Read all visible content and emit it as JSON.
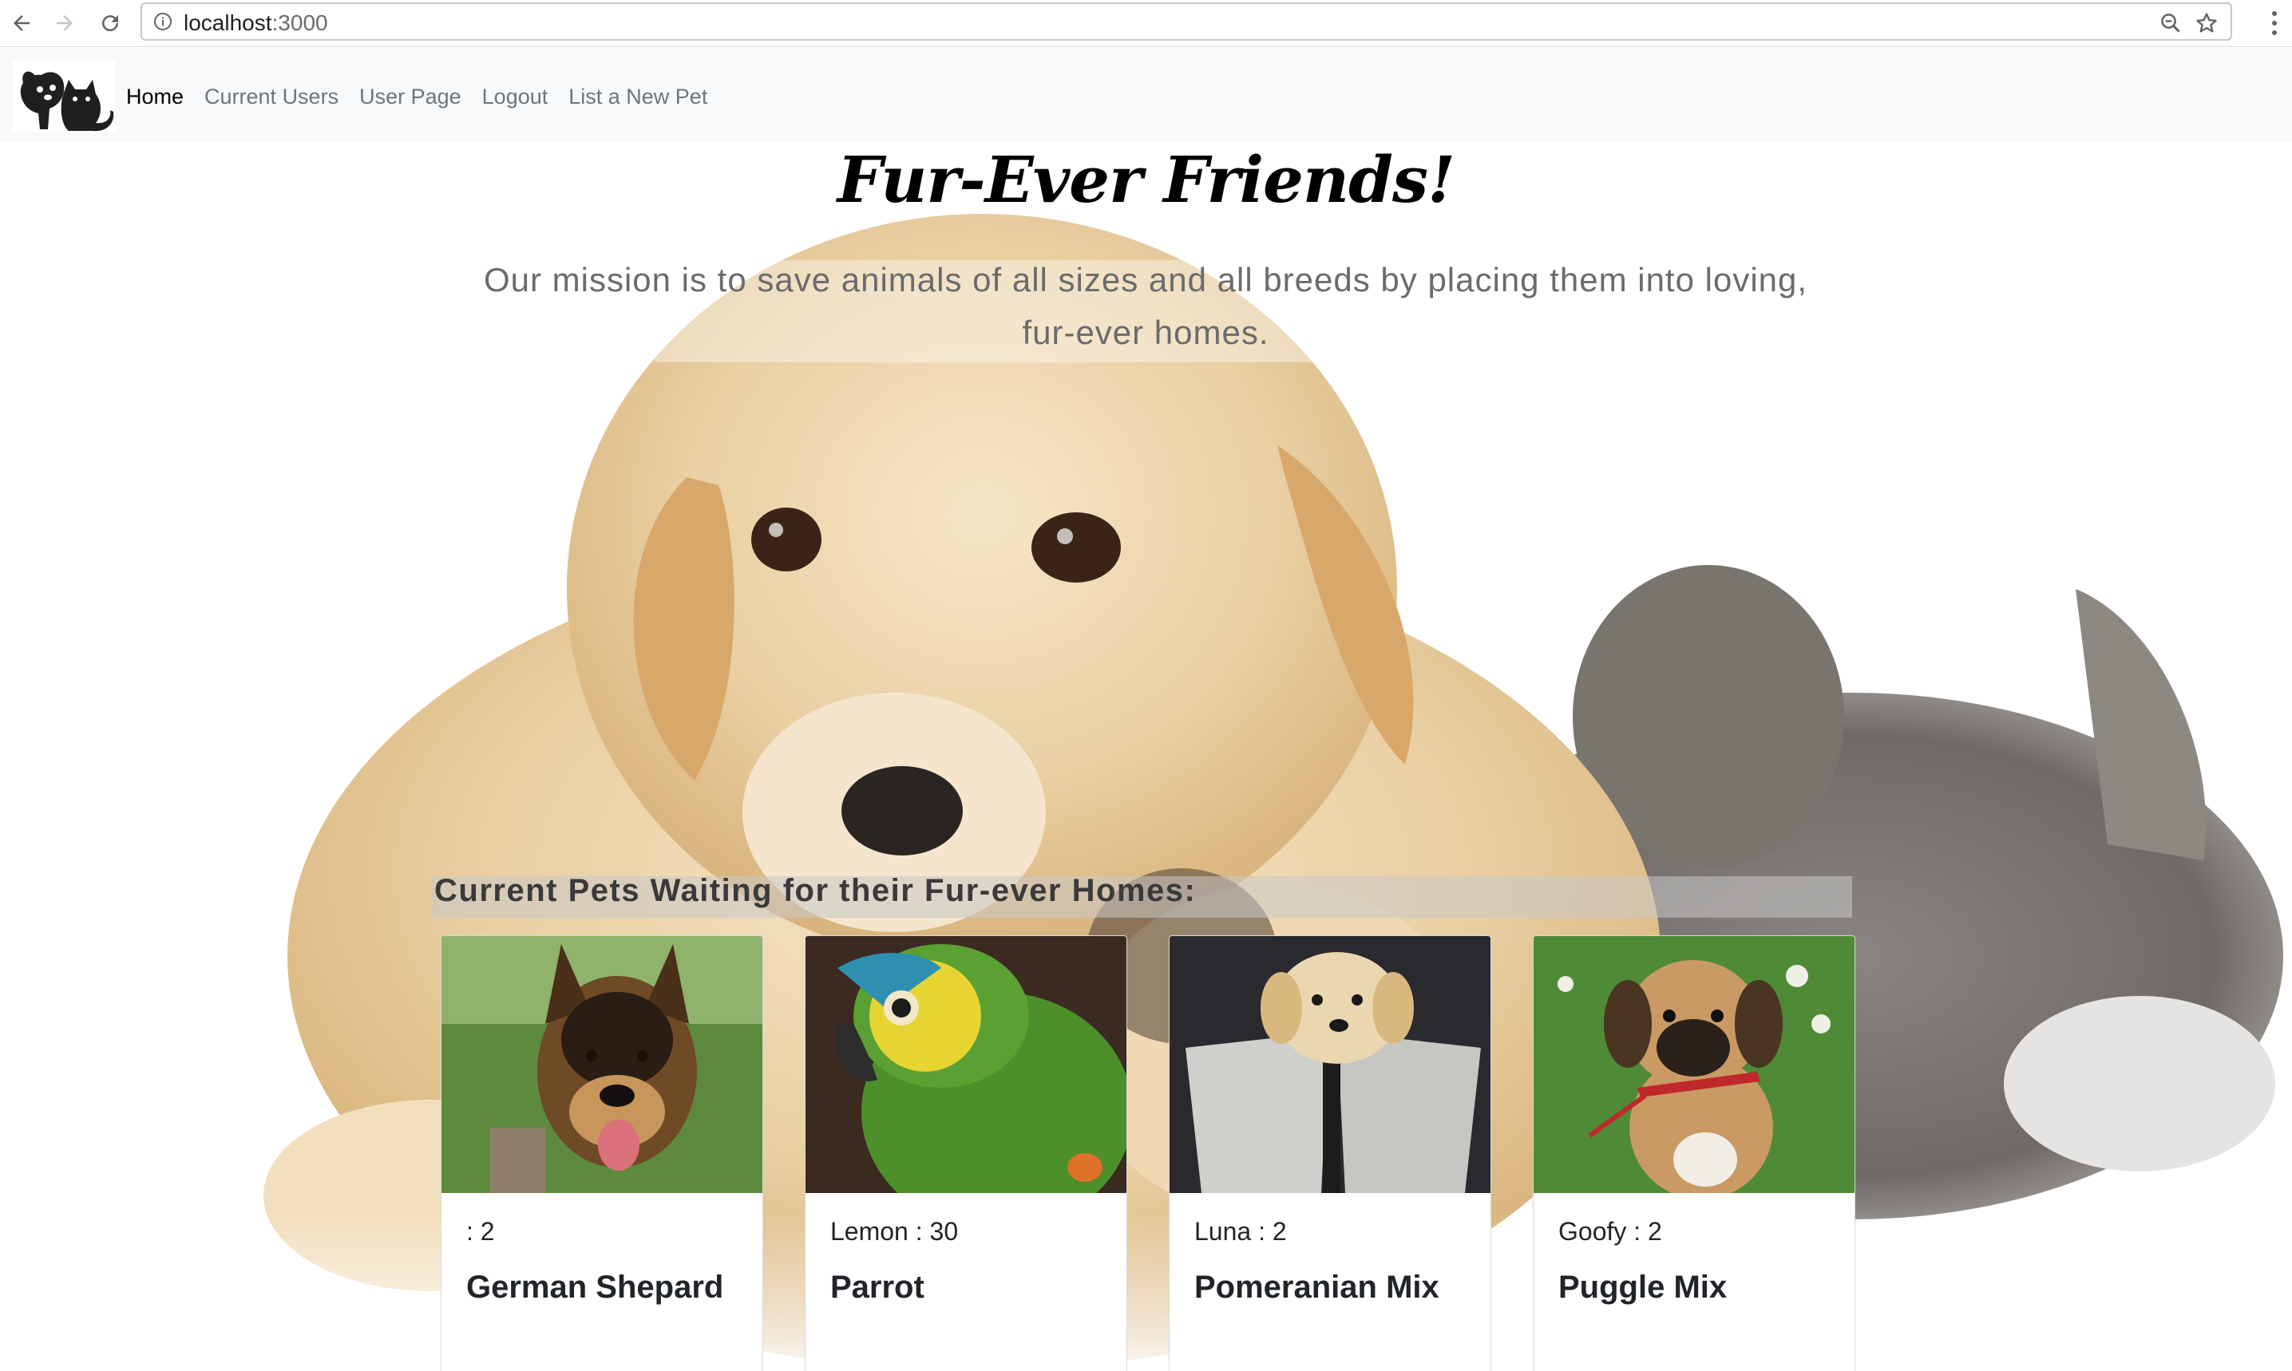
{
  "browser": {
    "url_host": "localhost",
    "url_port": ":3000",
    "icons": [
      "back-arrow-icon",
      "forward-arrow-icon",
      "reload-icon",
      "info-icon",
      "zoom-icon",
      "star-icon",
      "menu-icon"
    ]
  },
  "navbar": {
    "links": [
      {
        "label": "Home",
        "active": true
      },
      {
        "label": "Current Users"
      },
      {
        "label": "User Page"
      },
      {
        "label": "Logout"
      },
      {
        "label": "List a New Pet"
      }
    ]
  },
  "hero": {
    "title": "Fur-Ever Friends!",
    "mission_line1": "Our mission is to save animals of all sizes and all breeds by placing them into loving,",
    "mission_line2": "fur-ever homes."
  },
  "pets": {
    "heading": "Current Pets Waiting for their Fur-ever Homes:",
    "cards": [
      {
        "subtitle": ": 2",
        "breed": "German Shepard",
        "photo": "german-shepherd-photo"
      },
      {
        "subtitle": "Lemon : 30",
        "breed": "Parrot",
        "photo": "green-parrot-photo"
      },
      {
        "subtitle": "Luna : 2",
        "breed": "Pomeranian Mix",
        "photo": "small-dog-menu-photo"
      },
      {
        "subtitle": "Goofy : 2",
        "breed": "Puggle Mix",
        "photo": "puggle-puppy-photo"
      }
    ]
  },
  "colors": {
    "navbar_bg": "#f8f9fa",
    "nav_link": "#6c757d",
    "nav_link_active": "#000000",
    "mission_text": "#6b6b6b"
  }
}
